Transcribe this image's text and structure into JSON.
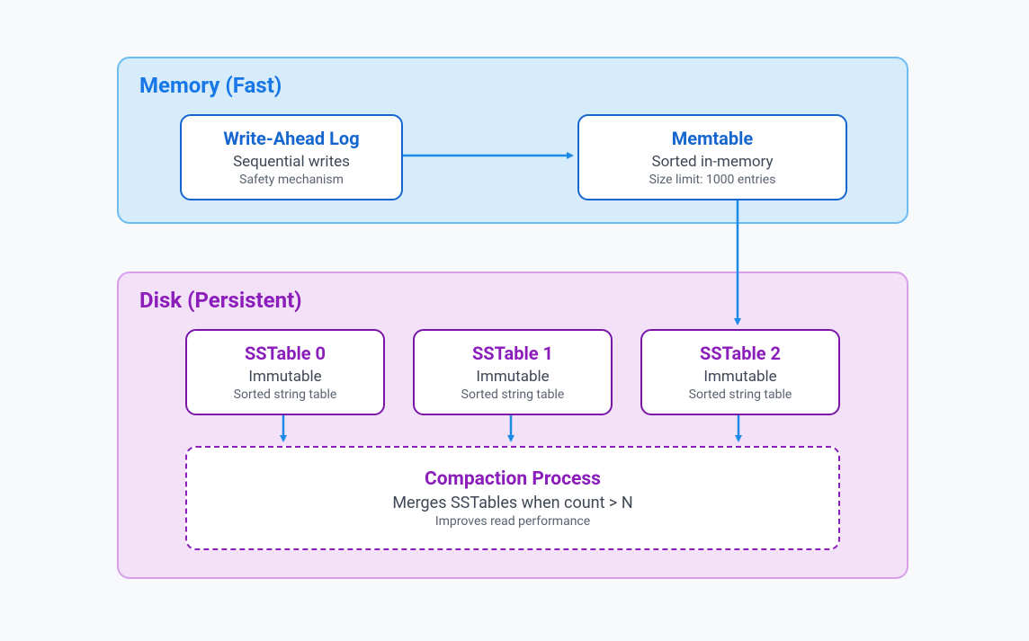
{
  "memory": {
    "title": "Memory (Fast)",
    "color": "#1877e6",
    "bg": "#d6ecfb",
    "border": "#6cbcf2",
    "wal": {
      "title": "Write-Ahead Log",
      "sub": "Sequential writes",
      "small": "Safety mechanism"
    },
    "memtable": {
      "title": "Memtable",
      "sub": "Sorted in-memory",
      "small": "Size limit: 1000 entries"
    }
  },
  "disk": {
    "title": "Disk (Persistent)",
    "color": "#8b1dbb",
    "bg": "#f3e1f8",
    "border": "#d79eea",
    "sstables": [
      {
        "title": "SSTable 0",
        "sub": "Immutable",
        "small": "Sorted string table"
      },
      {
        "title": "SSTable 1",
        "sub": "Immutable",
        "small": "Sorted string table"
      },
      {
        "title": "SSTable 2",
        "sub": "Immutable",
        "small": "Sorted string table"
      }
    ],
    "compaction": {
      "title": "Compaction Process",
      "sub": "Merges SSTables when count > N",
      "small": "Improves read performance"
    }
  },
  "arrow_color": "#1d8ae6"
}
